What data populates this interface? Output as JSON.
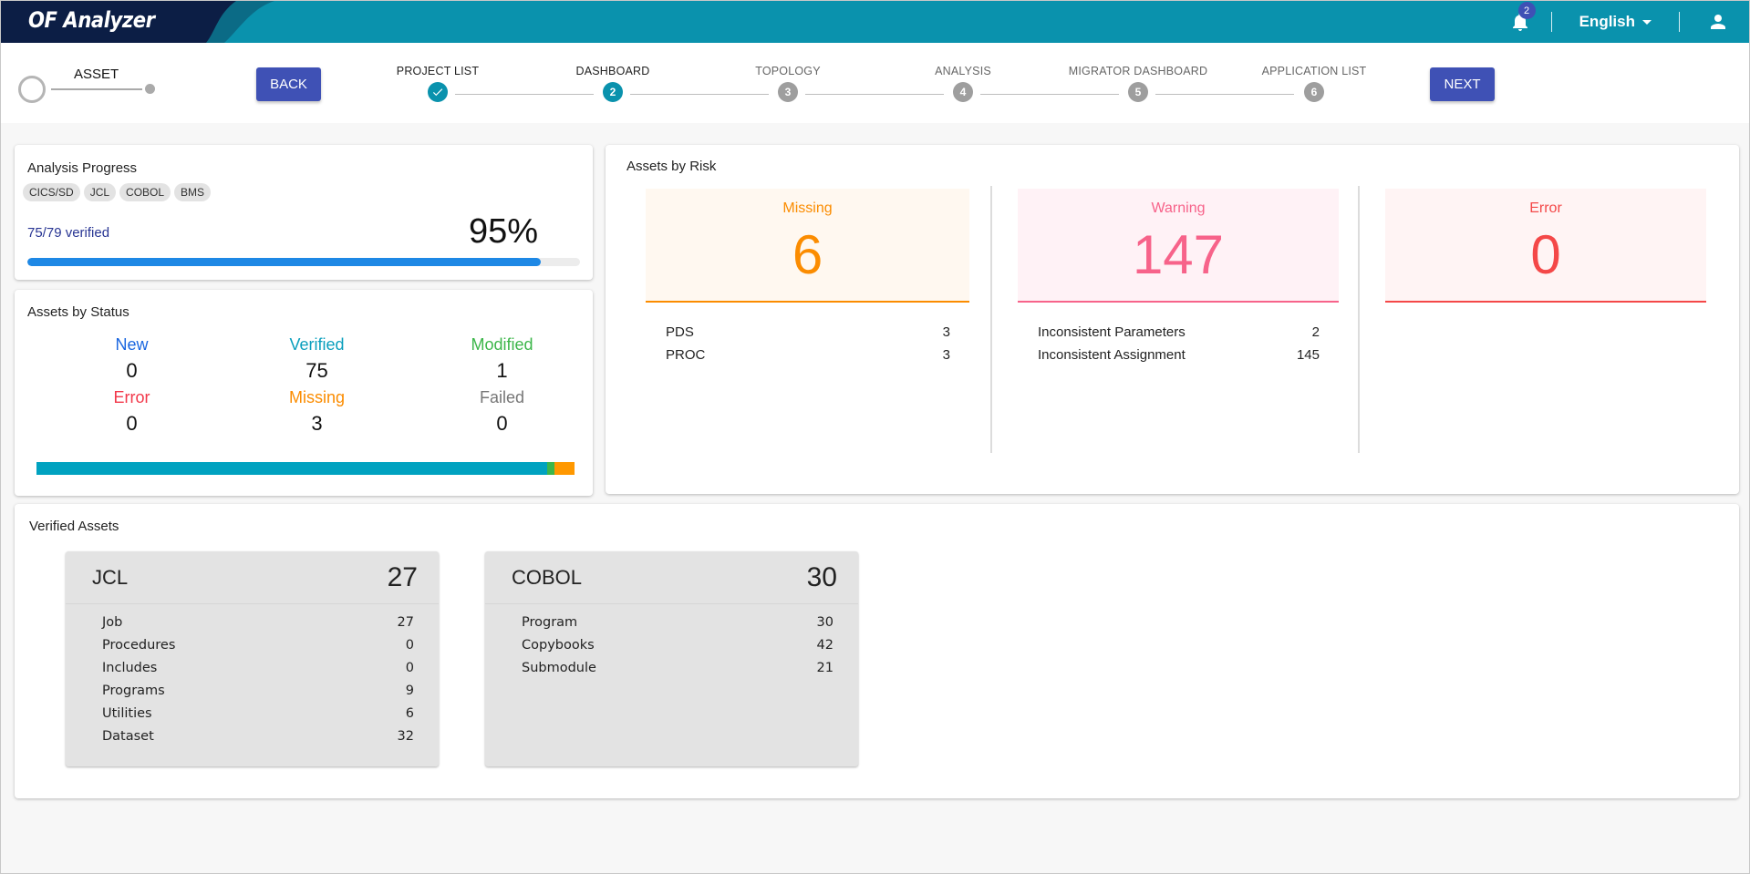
{
  "app": {
    "title": "OF Analyzer",
    "notification_count": "2",
    "language": "English"
  },
  "stepper": {
    "asset_label": "ASSET",
    "back_label": "BACK",
    "next_label": "NEXT",
    "steps": [
      {
        "label": "PROJECT LIST",
        "number": "1",
        "state": "done"
      },
      {
        "label": "DASHBOARD",
        "number": "2",
        "state": "active"
      },
      {
        "label": "TOPOLOGY",
        "number": "3",
        "state": "pending"
      },
      {
        "label": "ANALYSIS",
        "number": "4",
        "state": "pending"
      },
      {
        "label": "MIGRATOR DASHBOARD",
        "number": "5",
        "state": "pending"
      },
      {
        "label": "APPLICATION LIST",
        "number": "6",
        "state": "pending"
      }
    ]
  },
  "analysis_progress": {
    "title": "Analysis Progress",
    "chips": [
      "CICS/SD",
      "JCL",
      "COBOL",
      "BMS"
    ],
    "verified_text": "75/79 verified",
    "percent_text": "95%",
    "percent": 95,
    "bar_color": "#1e88e5"
  },
  "assets_by_status": {
    "title": "Assets by Status",
    "items": [
      {
        "label": "New",
        "value": "0",
        "color": "#1a66e0"
      },
      {
        "label": "Verified",
        "value": "75",
        "color": "#0a9fbd"
      },
      {
        "label": "Modified",
        "value": "1",
        "color": "#3cb64a"
      },
      {
        "label": "Error",
        "value": "0",
        "color": "#f2384a"
      },
      {
        "label": "Missing",
        "value": "3",
        "color": "#fb8c00"
      },
      {
        "label": "Failed",
        "value": "0",
        "color": "#777777"
      }
    ],
    "stacked_bar": [
      {
        "name": "Verified",
        "value": 75,
        "color": "#00a2c0"
      },
      {
        "name": "Modified",
        "value": 1,
        "color": "#3cb64a"
      },
      {
        "name": "Missing",
        "value": 3,
        "color": "#ff9800"
      }
    ]
  },
  "assets_by_risk": {
    "title": "Assets by Risk",
    "categories": [
      {
        "name": "Missing",
        "count": "6",
        "color": "#fb8c00",
        "bg": "#fff8f0",
        "items": [
          {
            "label": "PDS",
            "value": "3"
          },
          {
            "label": "PROC",
            "value": "3"
          }
        ]
      },
      {
        "name": "Warning",
        "count": "147",
        "color": "#f7638a",
        "bg": "#fff2f6",
        "items": [
          {
            "label": "Inconsistent Parameters",
            "value": "2"
          },
          {
            "label": "Inconsistent Assignment",
            "value": "145"
          }
        ]
      },
      {
        "name": "Error",
        "count": "0",
        "color": "#f44848",
        "bg": "#fff4f4",
        "items": []
      }
    ]
  },
  "verified_assets": {
    "title": "Verified Assets",
    "groups": [
      {
        "name": "JCL",
        "total": "27",
        "items": [
          {
            "label": "Job",
            "value": "27"
          },
          {
            "label": "Procedures",
            "value": "0"
          },
          {
            "label": "Includes",
            "value": "0"
          },
          {
            "label": "Programs",
            "value": "9"
          },
          {
            "label": "Utilities",
            "value": "6"
          },
          {
            "label": "Dataset",
            "value": "32"
          }
        ]
      },
      {
        "name": "COBOL",
        "total": "30",
        "items": [
          {
            "label": "Program",
            "value": "30"
          },
          {
            "label": "Copybooks",
            "value": "42"
          },
          {
            "label": "Submodule",
            "value": "21"
          }
        ]
      }
    ]
  }
}
